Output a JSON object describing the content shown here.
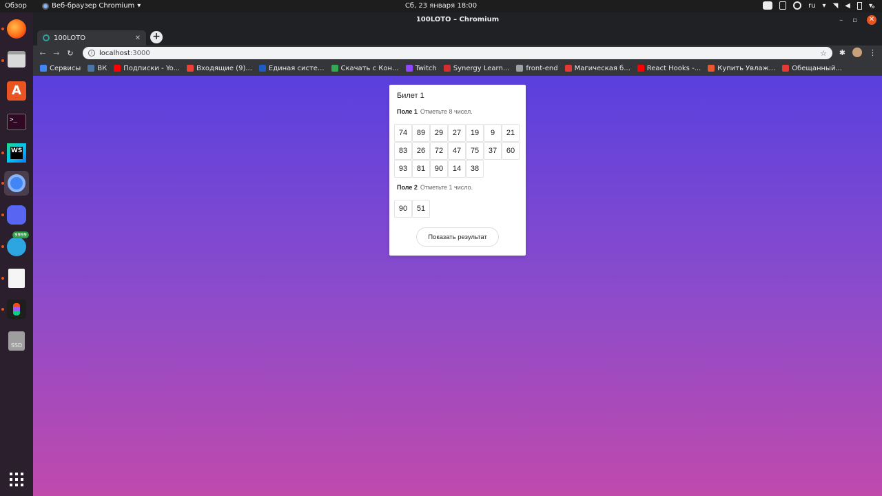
{
  "topbar": {
    "overview": "Обзор",
    "app_menu": "Веб-браузер Chromium",
    "clock": "Сб, 23 января  18:00",
    "lang": "ru"
  },
  "dock": {
    "telegram_badge": "9999",
    "ssd_label": "SSD"
  },
  "window": {
    "title": "100LOTO – Chromium",
    "tab_title": "100LOTO",
    "url_host": "localhost",
    "url_port": ":3000"
  },
  "bookmarks": [
    {
      "label": "Сервисы",
      "color": "#4285f4"
    },
    {
      "label": "ВК",
      "color": "#4a76a8"
    },
    {
      "label": "Подписки - Yo...",
      "color": "#ff0000"
    },
    {
      "label": "Входящие (9)...",
      "color": "#ea4335"
    },
    {
      "label": "Единая систе...",
      "color": "#1e5bc6"
    },
    {
      "label": "Скачать с Кон...",
      "color": "#34a853"
    },
    {
      "label": "Twitch",
      "color": "#9146ff"
    },
    {
      "label": "Synergy Learn...",
      "color": "#d32f2f"
    },
    {
      "label": "front-end",
      "color": "#9aa0a6"
    },
    {
      "label": "Магическая б...",
      "color": "#e53935"
    },
    {
      "label": "React Hooks -...",
      "color": "#ff0000"
    },
    {
      "label": "Купить Увлаж...",
      "color": "#e8572f"
    },
    {
      "label": "Обещанный...",
      "color": "#e53935"
    }
  ],
  "ticket": {
    "title": "Билет 1",
    "field1": {
      "name": "Поле 1",
      "hint": "Отметьте 8 чисел.",
      "numbers": [
        "74",
        "89",
        "29",
        "27",
        "19",
        "9",
        "21",
        "83",
        "26",
        "72",
        "47",
        "75",
        "37",
        "60",
        "93",
        "81",
        "90",
        "14",
        "38"
      ]
    },
    "field2": {
      "name": "Поле 2",
      "hint": "Отметьте 1 число.",
      "numbers": [
        "90",
        "51"
      ]
    },
    "result_button": "Показать результат"
  }
}
